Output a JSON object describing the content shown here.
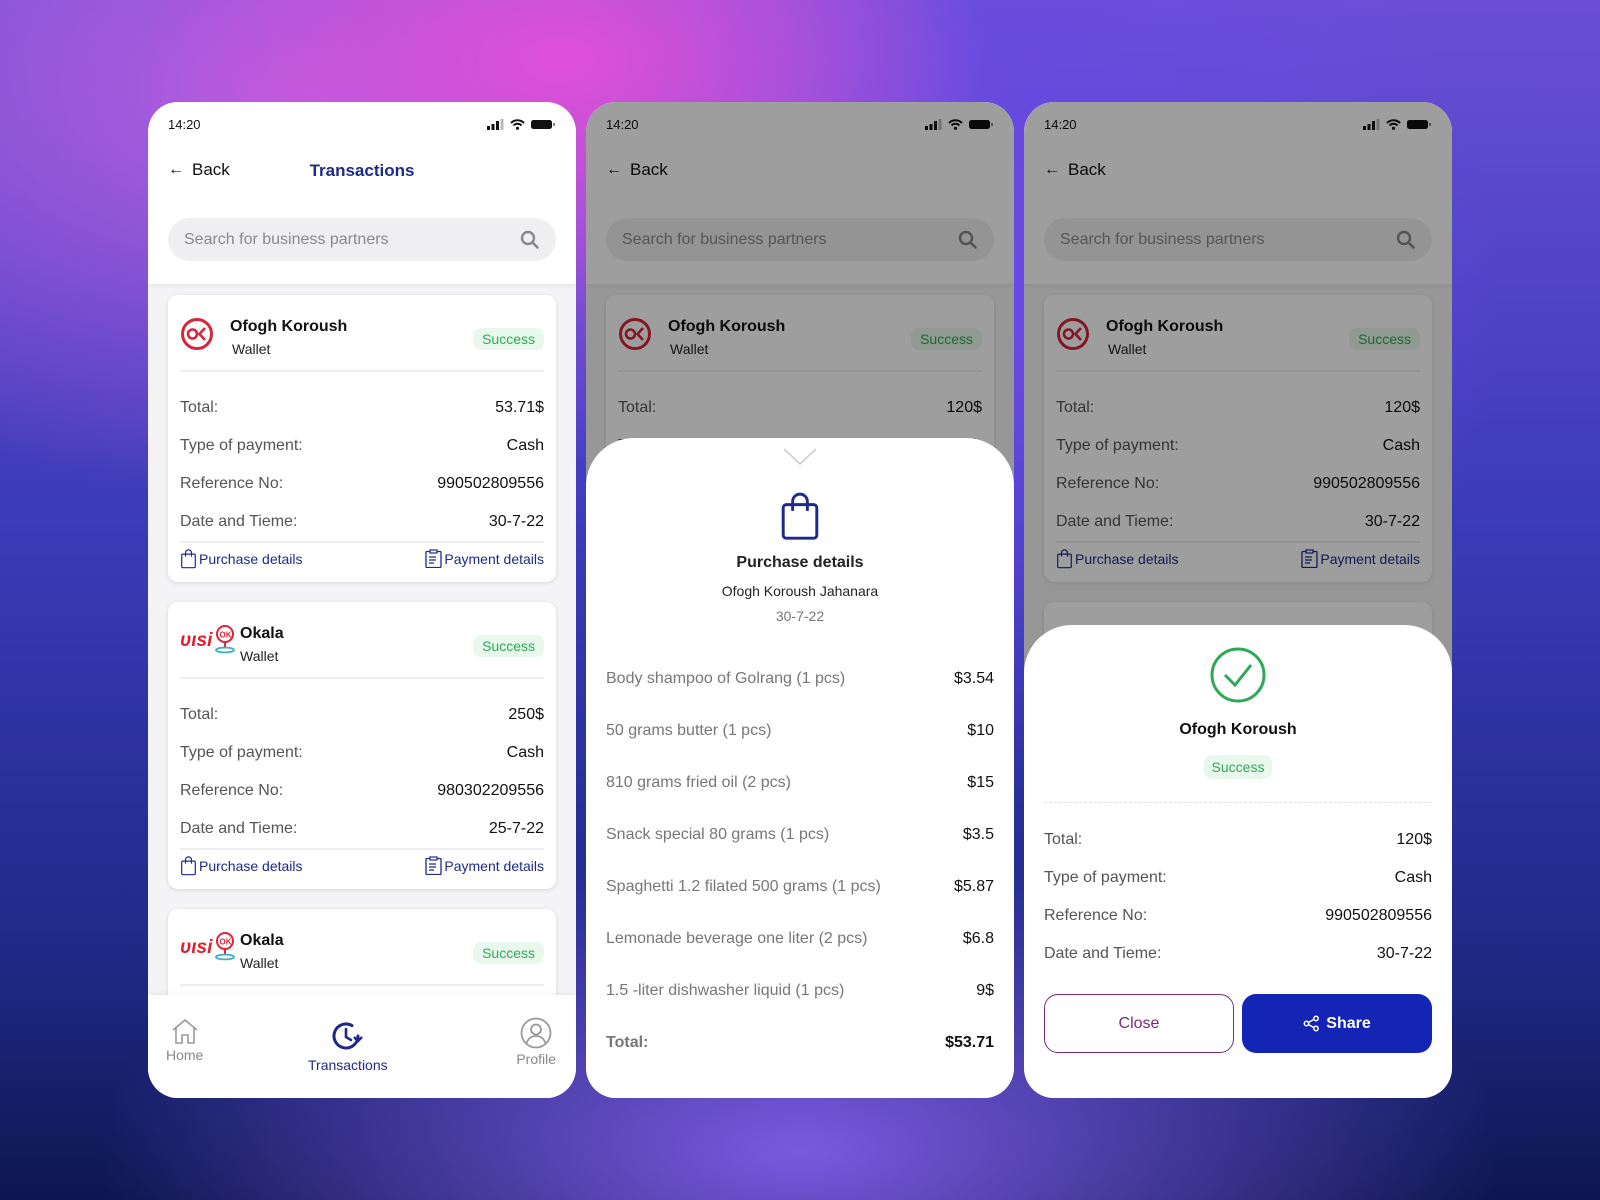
{
  "status_time": "14:20",
  "back_label": "Back",
  "header_title": "Transactions",
  "search_placeholder": "Search for business partners",
  "labels": {
    "total": "Total:",
    "type": "Type of payment:",
    "ref": "Reference No:",
    "date": "Date and Tieme:",
    "purchase": "Purchase details",
    "payment": "Payment details"
  },
  "screen1": {
    "cards": [
      {
        "name": "Ofogh Koroush",
        "sub": "Wallet",
        "status": "Success",
        "logo": "ofogh-koroush-logo",
        "total": "53.71$",
        "type": "Cash",
        "ref": "990502809556",
        "date": "30-7-22"
      },
      {
        "name": "Okala",
        "sub": "Wallet",
        "status": "Success",
        "logo": "okala-logo",
        "total": "250$",
        "type": "Cash",
        "ref": "980302209556",
        "date": "25-7-22"
      },
      {
        "name": "Okala",
        "sub": "Wallet",
        "status": "Success",
        "logo": "okala-logo"
      }
    ]
  },
  "screen_bg_card": {
    "name": "Ofogh Koroush",
    "sub": "Wallet",
    "status": "Success",
    "logo": "ofogh-koroush-logo",
    "total": "120$",
    "type": "Cash",
    "ref": "990502809556",
    "date": "30-7-22"
  },
  "nav": [
    {
      "label": "Home",
      "icon": "home-icon"
    },
    {
      "label": "Transactions",
      "icon": "history-icon",
      "active": true
    },
    {
      "label": "Profile",
      "icon": "profile-icon"
    }
  ],
  "purchase_sheet": {
    "title": "Purchase details",
    "merchant": "Ofogh Koroush Jahanara",
    "date": "30-7-22",
    "items": [
      {
        "name": "Body shampoo of Golrang (1 pcs)",
        "price": "$3.54"
      },
      {
        "name": "50 grams butter (1 pcs)",
        "price": "$10"
      },
      {
        "name": "810 grams fried oil (2 pcs)",
        "price": "$15"
      },
      {
        "name": "Snack special 80 grams (1 pcs)",
        "price": "$3.5"
      },
      {
        "name": "Spaghetti 1.2 filated 500 grams (1 pcs)",
        "price": "$5.87"
      },
      {
        "name": "Lemonade beverage one liter (2 pcs)",
        "price": "$6.8"
      },
      {
        "name": "1.5 -liter dishwasher liquid (1 pcs)",
        "price": "9$"
      }
    ],
    "total_label": "Total:",
    "total": "$53.71"
  },
  "payment_sheet": {
    "merchant": "Ofogh Koroush",
    "status": "Success",
    "total": "120$",
    "type": "Cash",
    "ref": "990502809556",
    "date": "30-7-22",
    "close_label": "Close",
    "share_label": "Share"
  },
  "colors": {
    "brand": "#1e2a8a",
    "share_button": "#1424b4",
    "success": "#2eaa55",
    "success_bg": "#e8f8ec"
  }
}
